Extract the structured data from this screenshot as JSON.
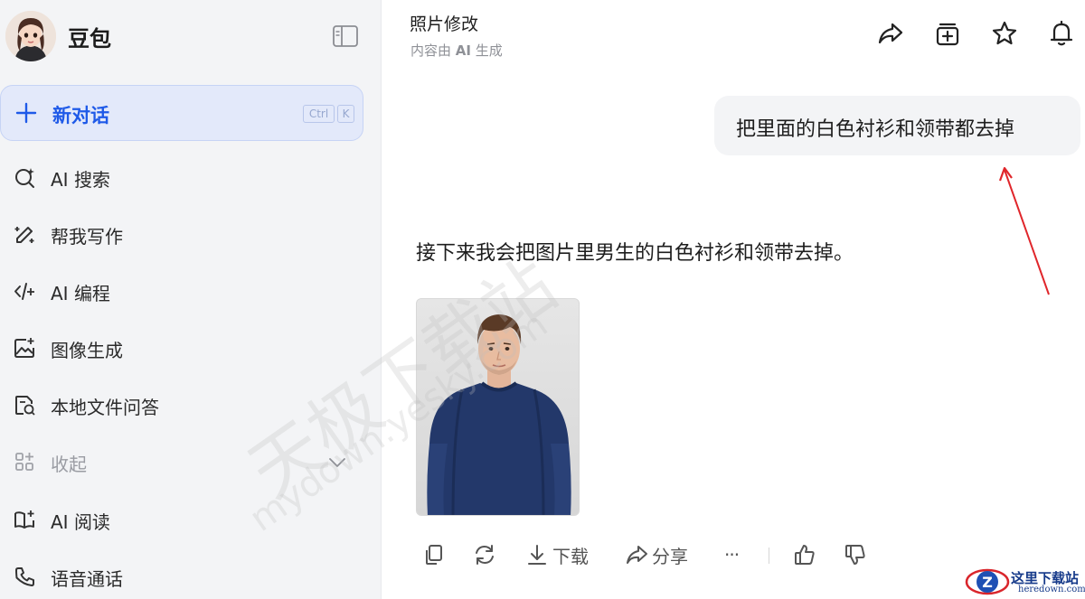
{
  "app": {
    "brand_name": "豆包",
    "new_chat_label": "新对话",
    "shortcut_ctrl": "Ctrl",
    "shortcut_key": "K"
  },
  "sidebar": {
    "items": [
      {
        "label": "AI 搜索",
        "icon": "ai-search-icon"
      },
      {
        "label": "帮我写作",
        "icon": "writing-icon"
      },
      {
        "label": "AI 编程",
        "icon": "code-icon"
      },
      {
        "label": "图像生成",
        "icon": "image-gen-icon"
      },
      {
        "label": "本地文件问答",
        "icon": "file-qa-icon"
      },
      {
        "label": "收起",
        "icon": "apps-icon"
      },
      {
        "label": "AI 阅读",
        "icon": "reading-icon"
      },
      {
        "label": "语音通话",
        "icon": "phone-icon"
      }
    ]
  },
  "header": {
    "title": "照片修改",
    "subtitle_prefix": "内容由 ",
    "subtitle_ai": "AI",
    "subtitle_suffix": " 生成"
  },
  "chat": {
    "user_message": "把里面的白色衬衫和领带都去掉",
    "assistant_message": "接下来我会把图片里男生的白色衬衫和领带去掉。"
  },
  "actions": {
    "download_label": "下载",
    "share_label": "分享",
    "more_label": "···"
  },
  "watermark": {
    "text_cn": "天极下载站",
    "text_en": "mydown.yesky.com"
  },
  "corner_logo": {
    "name": "这里下载站",
    "domain": "heredown.com"
  },
  "colors": {
    "accent": "#1f5ae8",
    "sidebar_bg": "#f3f4f6",
    "new_chat_bg": "#e3e9fa",
    "arrow_red": "#e0262b"
  }
}
